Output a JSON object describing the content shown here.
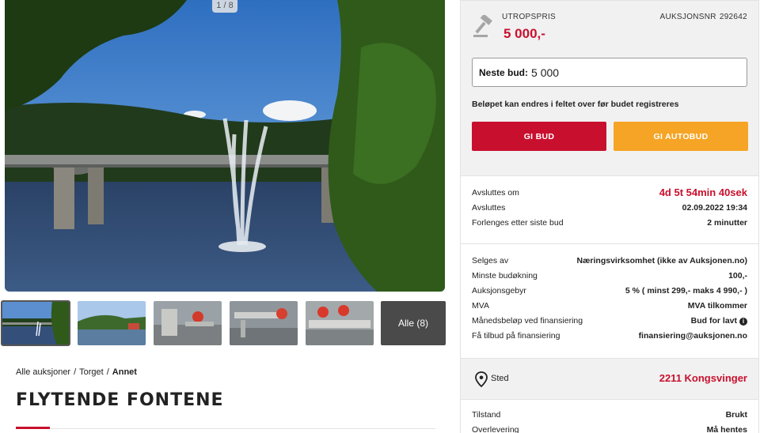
{
  "gallery": {
    "counter": "1 / 8",
    "all_label": "Alle (8)"
  },
  "breadcrumb": {
    "items": [
      "Alle auksjoner",
      "Torget",
      "Annet"
    ],
    "separator": "/"
  },
  "title": "FLYTENDE FONTENE",
  "bid": {
    "start_label": "UTROPSPRIS",
    "start_value": "5 000,-",
    "auction_label": "AUKSJONSNR",
    "auction_no": "292642",
    "next_bid_label": "Neste bud:",
    "next_bid_value": "5 000",
    "hint": "Beløpet kan endres i feltet over før budet registreres",
    "bid_button": "GI BUD",
    "autobid_button": "GI AUTOBUD"
  },
  "timing": [
    {
      "label": "Avsluttes om",
      "value": "4d 5t 54min 40sek",
      "highlight": true
    },
    {
      "label": "Avsluttes",
      "value": "02.09.2022 19:34",
      "highlight": false
    },
    {
      "label": "Forlenges etter siste bud",
      "value": "2 minutter",
      "highlight": false
    }
  ],
  "details": [
    {
      "label": "Selges av",
      "value": "Næringsvirksomhet (ikke av Auksjonen.no)"
    },
    {
      "label": "Minste budøkning",
      "value": "100,-"
    },
    {
      "label": "Auksjonsgebyr",
      "value": "5 % ( minst 299,- maks 4 990,- )"
    },
    {
      "label": "MVA",
      "value": "MVA tilkommer"
    },
    {
      "label": "Månedsbeløp ved finansiering",
      "value": "Bud for lavt"
    },
    {
      "label": "Få tilbud på finansiering",
      "value": "finansiering@auksjonen.no"
    }
  ],
  "location": {
    "label": "Sted",
    "value": "2211 Kongsvinger"
  },
  "condition": [
    {
      "label": "Tilstand",
      "value": "Brukt"
    },
    {
      "label": "Overlevering",
      "value": "Må hentes"
    }
  ],
  "colors": {
    "accent": "#c8102e",
    "autobid": "#f6a425",
    "panel_bg": "#f1f1f1"
  }
}
